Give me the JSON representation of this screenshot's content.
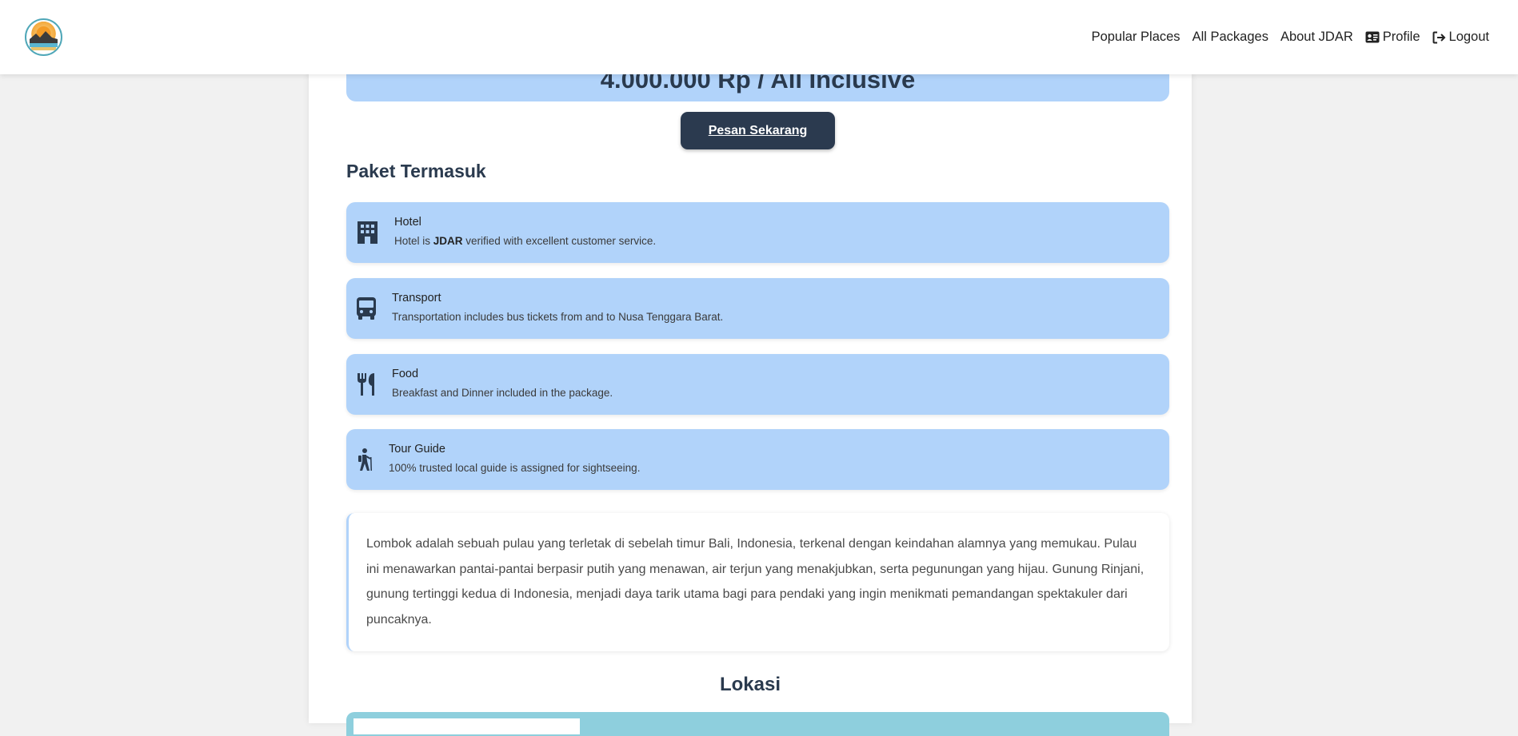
{
  "nav": {
    "logo_alt": "JDAR",
    "links": [
      {
        "label": "Popular Places"
      },
      {
        "label": "All Packages"
      },
      {
        "label": "About JDAR"
      },
      {
        "label": "Profile",
        "icon": "id-card-icon"
      },
      {
        "label": "Logout",
        "icon": "logout-icon"
      }
    ]
  },
  "package": {
    "price": "4.000.000 Rp / All Inclusive",
    "order_button": "Pesan Sekarang",
    "includes_title": "Paket Termasuk",
    "includes": [
      {
        "icon": "hotel-building-icon",
        "title": "Hotel",
        "desc_prefix": "Hotel is ",
        "desc_bold": "JDAR",
        "desc_suffix": " verified with excellent customer service."
      },
      {
        "icon": "bus-icon",
        "title": "Transport",
        "desc": "Transportation includes bus tickets from and to Nusa Tenggara Barat."
      },
      {
        "icon": "utensils-icon",
        "title": "Food",
        "desc": "Breakfast and Dinner included in the package."
      },
      {
        "icon": "hiking-person-icon",
        "title": "Tour Guide",
        "desc": "100% trusted local guide is assigned for sightseeing."
      }
    ],
    "description": "Lombok adalah sebuah pulau yang terletak di sebelah timur Bali, Indonesia, terkenal dengan keindahan alamnya yang memukau. Pulau ini menawarkan pantai-pantai berpasir putih yang menawan, air terjun yang menakjubkan, serta pegunungan yang hijau. Gunung Rinjani, gunung tertinggi kedua di Indonesia, menjadi daya tarik utama bagi para pendaki yang ingin menikmati pemandangan spektakuler dari puncaknya.",
    "location_title": "Lokasi"
  },
  "colors": {
    "accent": "#b1d3fa",
    "button": "#2b3a4f",
    "map": "#8ecfdd"
  }
}
